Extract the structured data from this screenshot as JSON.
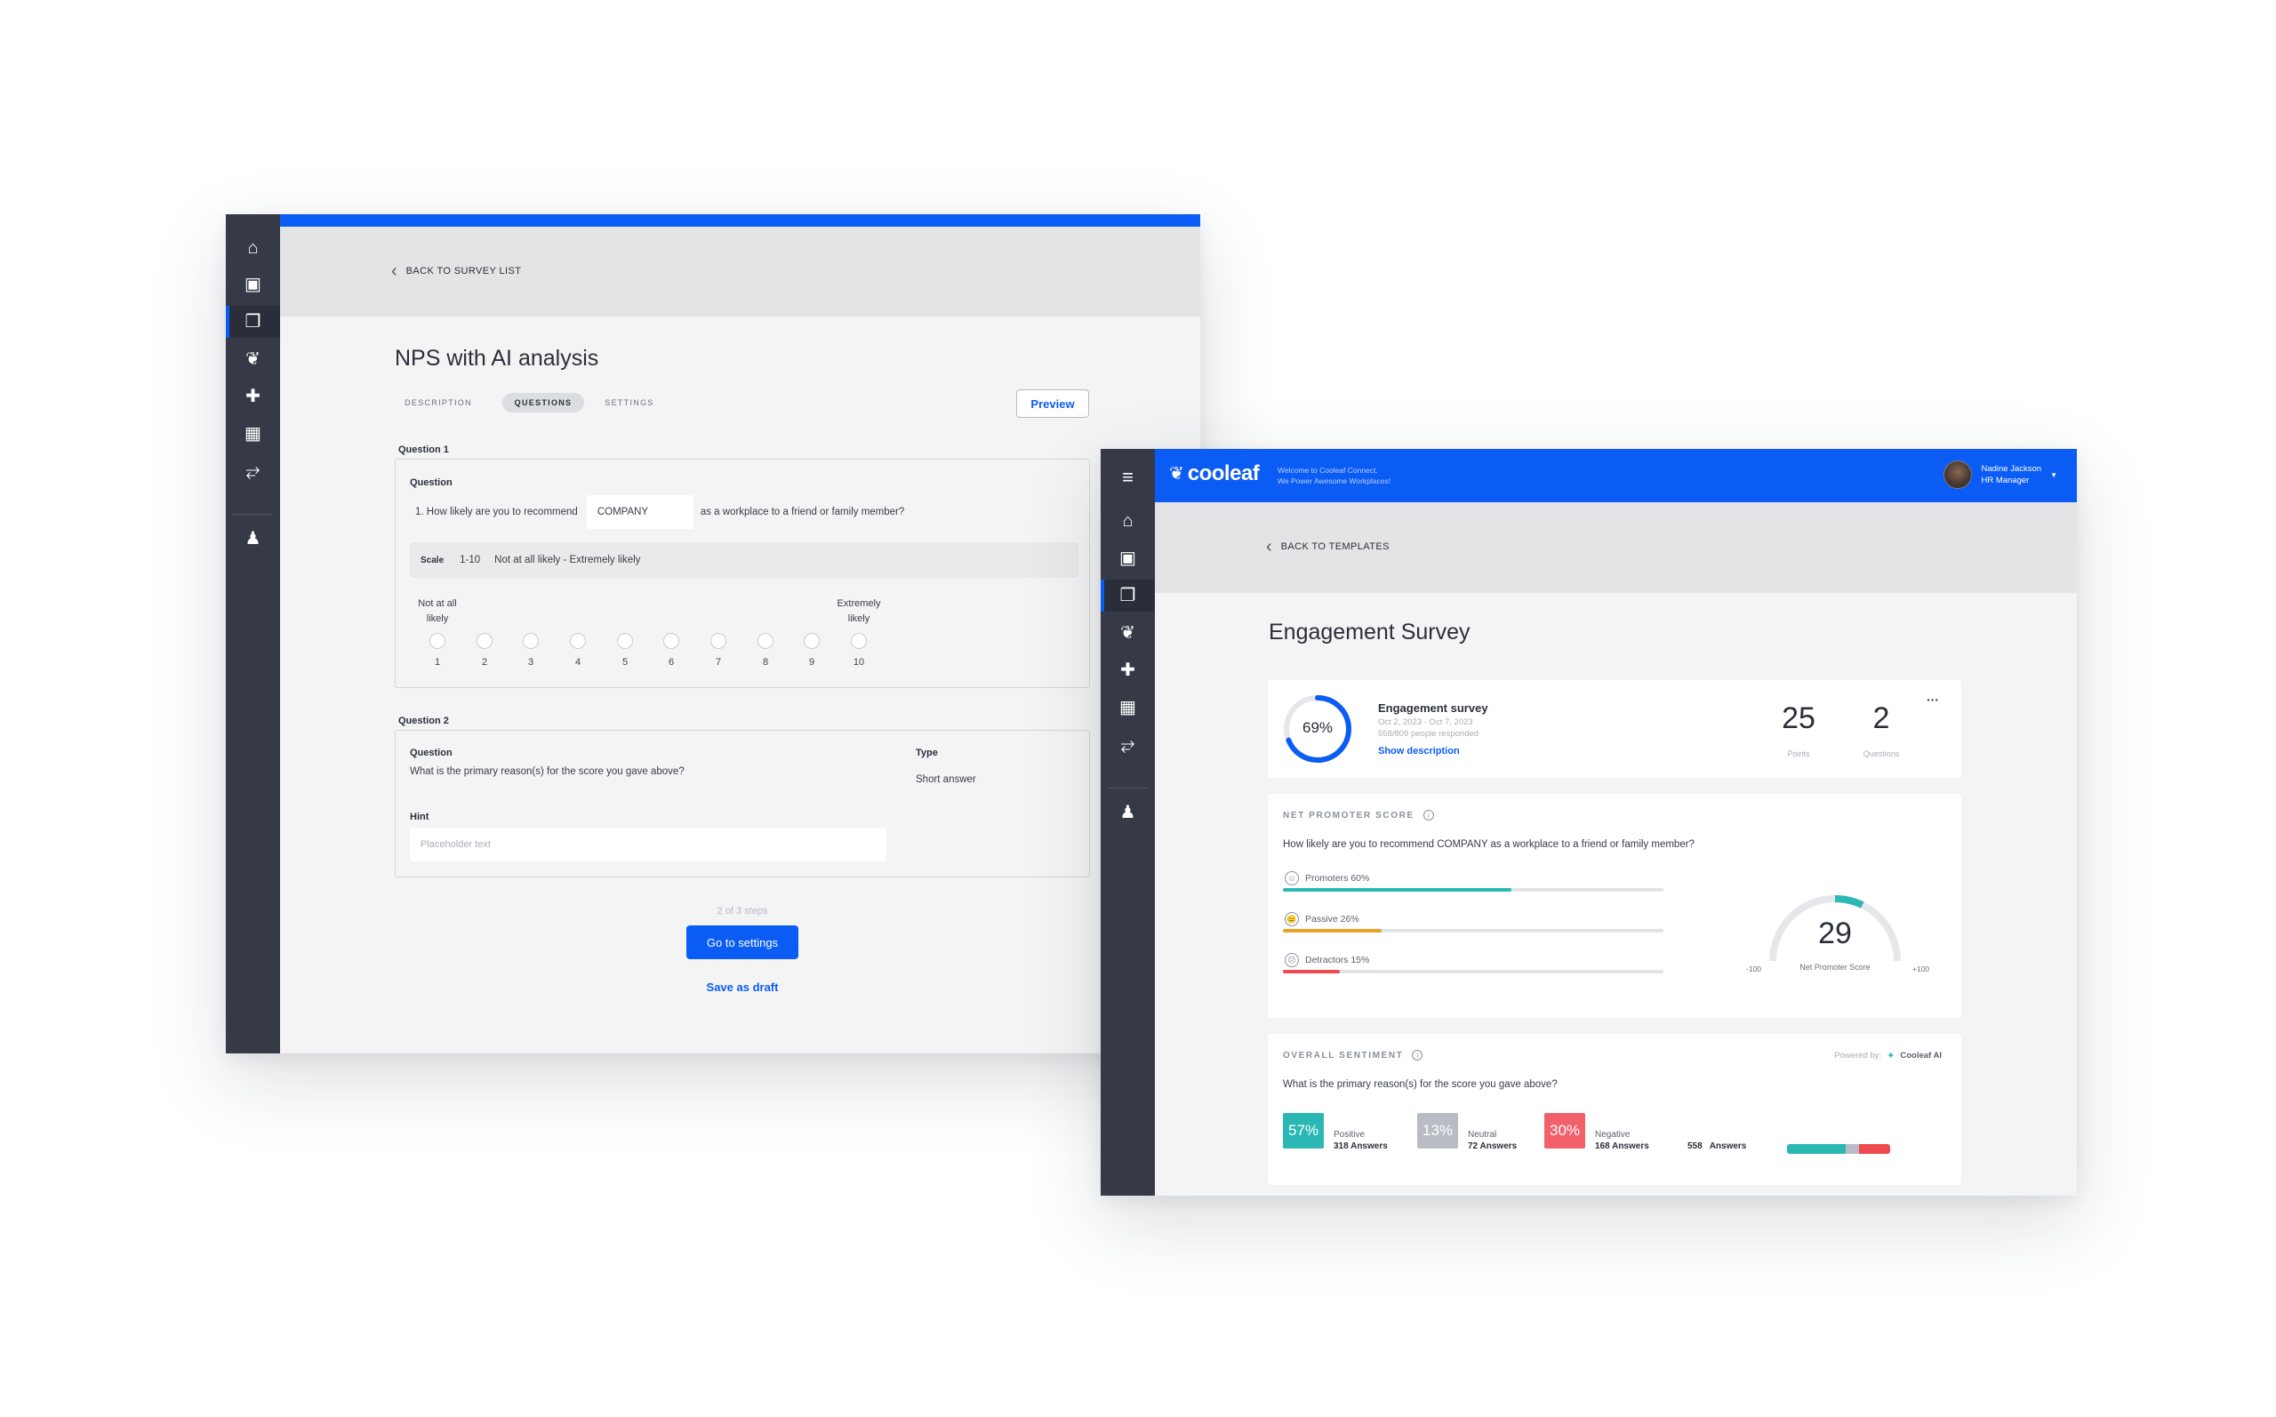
{
  "left_window": {
    "back_link": "BACK TO SURVEY LIST",
    "title": "NPS with AI analysis",
    "tabs": [
      {
        "label": "DESCRIPTION",
        "active": false
      },
      {
        "label": "QUESTIONS",
        "active": true
      },
      {
        "label": "SETTINGS",
        "active": false
      }
    ],
    "preview_label": "Preview",
    "q1": {
      "section_label": "Question 1",
      "question_label": "Question",
      "question_prefix": "1. How likely are you to recommend",
      "company_value": "COMPANY",
      "question_suffix": "as a workplace to a friend or family member?",
      "scale_label": "Scale",
      "scale_range": "1-10",
      "scale_desc": "Not at all likely - Extremely likely",
      "low_label": "Not at all likely",
      "high_label": "Extremely likely",
      "options": [
        "1",
        "2",
        "3",
        "4",
        "5",
        "6",
        "7",
        "8",
        "9",
        "10"
      ]
    },
    "q2": {
      "section_label": "Question 2",
      "question_label": "Question",
      "question_text": "What is the primary reason(s) for the score you gave above?",
      "type_label": "Type",
      "type_value": "Short answer",
      "hint_label": "Hint",
      "hint_placeholder": "Placeholder text"
    },
    "steps": "2 of 3 steps",
    "go_settings": "Go to settings",
    "save_draft": "Save as draft"
  },
  "right_window": {
    "brand": "cooleaf",
    "welcome_line1": "Welcome to Cooleaf Connect.",
    "welcome_line2": "We Power Awesome Workplaces!",
    "user_name": "Nadine Jackson",
    "user_role": "HR Manager",
    "back_link": "BACK TO TEMPLATES",
    "title": "Engagement Survey",
    "summary": {
      "percent": "69%",
      "percent_value": 0.69,
      "name": "Engagement survey",
      "dates": "Oct 2, 2023 - Oct 7, 2023",
      "responded": "558/809 people responded",
      "show_description": "Show description",
      "points_value": "25",
      "points_label": "Points",
      "questions_value": "2",
      "questions_label": "Questions",
      "more": "···"
    },
    "nps": {
      "section_label": "NET PROMOTER SCORE",
      "question": "How likely are you to recommend COMPANY as a workplace to a friend or family member?",
      "rows": [
        {
          "label": "Promoters 60%",
          "value": 0.6,
          "color": "#2bb8b4",
          "face": "☺"
        },
        {
          "label": "Passive 26%",
          "value": 0.26,
          "color": "#eba027",
          "face": "😐"
        },
        {
          "label": "Detractors 15%",
          "value": 0.15,
          "color": "#ee4a50",
          "face": "☹"
        }
      ],
      "score": "29",
      "score_value": 29,
      "score_label": "Net Promoter Score",
      "min_label": "-100",
      "max_label": "+100"
    },
    "sentiment": {
      "section_label": "OVERALL SENTIMENT",
      "powered_by": "Powered by:",
      "ai_name": "Cooleaf AI",
      "question": "What is the primary reason(s) for the score you gave above?",
      "items": [
        {
          "pct": "57%",
          "name": "Positive",
          "count": "318 Answers",
          "color": "#2bb8b4"
        },
        {
          "pct": "13%",
          "name": "Neutral",
          "count": "72 Answers",
          "color": "#b9bcc4"
        },
        {
          "pct": "30%",
          "name": "Negative",
          "count": "168 Answers",
          "color": "#f2606a"
        }
      ],
      "total_count": "558",
      "total_label": "Answers",
      "split": [
        {
          "value": 0.57,
          "color": "#2bb8b4"
        },
        {
          "value": 0.13,
          "color": "#b9bcc4"
        },
        {
          "value": 0.3,
          "color": "#ee4a50"
        }
      ]
    }
  },
  "icons": [
    "home-icon",
    "calendar-check-icon",
    "survey-icon",
    "heart-hands-icon",
    "gift-icon",
    "calendar-icon",
    "route-icon",
    "bell-icon",
    "menu-icon",
    "chevron-left-icon",
    "info-icon",
    "spark-icon",
    "caret-down-icon",
    "leaf-logo-icon"
  ]
}
